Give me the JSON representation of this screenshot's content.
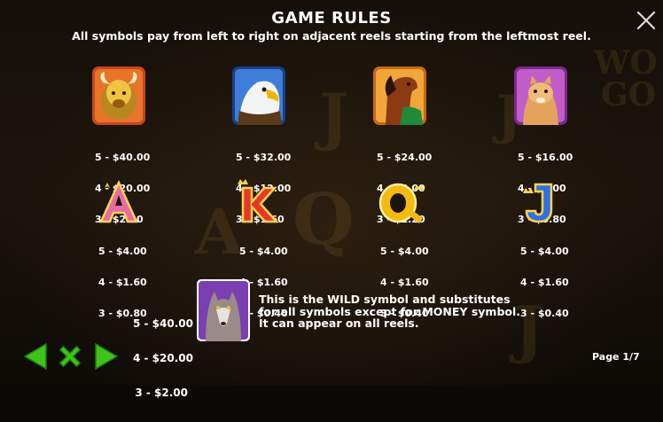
{
  "header": {
    "title": "GAME RULES",
    "subtitle": "All symbols pay from left to right on adjacent reels starting from the leftmost reel."
  },
  "symbols": [
    {
      "name": "bison",
      "pays": [
        "5 - $40.00",
        "4 - $20.00",
        "3 - $2.00"
      ]
    },
    {
      "name": "eagle",
      "pays": [
        "5 - $32.00",
        "4 - $12.00",
        "3 - $1.60"
      ]
    },
    {
      "name": "horse",
      "pays": [
        "5 - $24.00",
        "4 - $8.00",
        "3 - $1.20"
      ]
    },
    {
      "name": "cougar",
      "pays": [
        "5 - $16.00",
        "4 - $4.00",
        "3 - $0.80"
      ]
    },
    {
      "name": "A",
      "pays": [
        "5 - $4.00",
        "4 - $1.60",
        "3 - $0.80"
      ]
    },
    {
      "name": "K",
      "pays": [
        "5 - $4.00",
        "4 - $1.60",
        "3 - $0.40"
      ]
    },
    {
      "name": "Q",
      "pays": [
        "5 - $4.00",
        "4 - $1.60",
        "3 - $0.40"
      ]
    },
    {
      "name": "J",
      "pays": [
        "5 - $4.00",
        "4 - $1.60",
        "3 - $0.40"
      ]
    }
  ],
  "wild": {
    "pays": [
      "5 - $40.00",
      "4 - $20.00",
      "3 - $2.00"
    ],
    "description": [
      "This is the WILD symbol and substitutes",
      "for all symbols except for MONEY symbol.",
      "It can appear on all reels."
    ]
  },
  "footer": {
    "page": "Page 1/7"
  },
  "colors": {
    "nav_green": "#3fc21a",
    "text": "#ffffff",
    "background": "#14100a"
  }
}
